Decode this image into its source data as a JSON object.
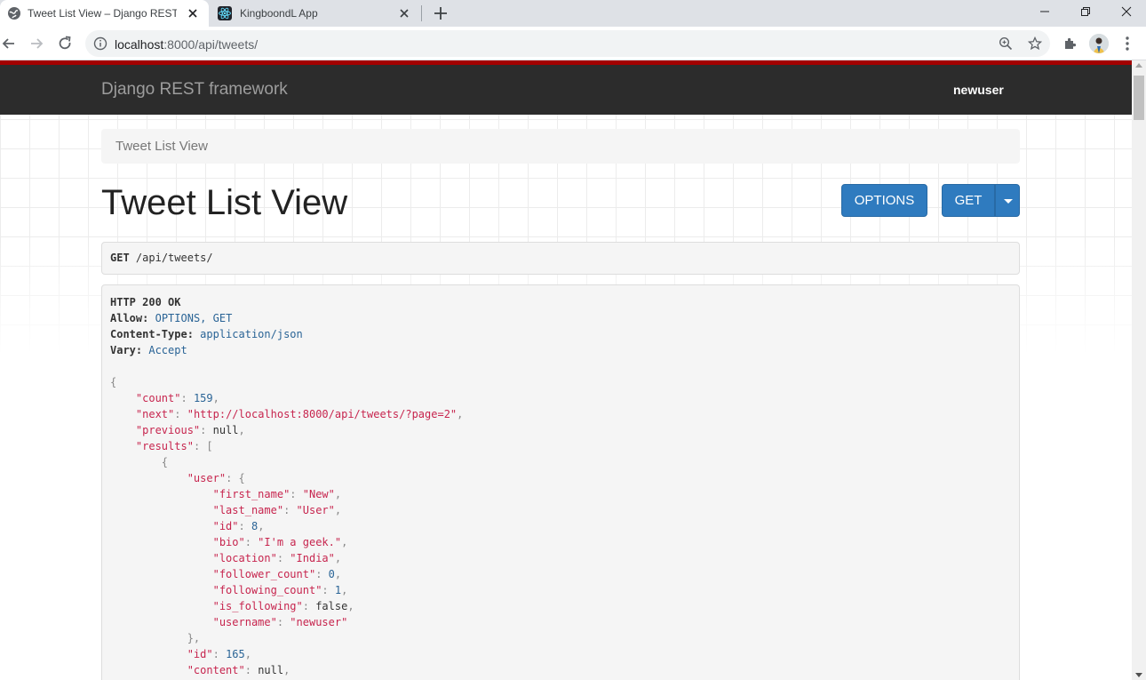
{
  "browser": {
    "tabs": [
      {
        "title": "Tweet List View – Django REST fra",
        "active": true
      },
      {
        "title": "KingboondL App",
        "active": false
      }
    ],
    "url_host": "localhost",
    "url_path": ":8000/api/tweets/"
  },
  "drf": {
    "brand": "Django REST framework",
    "user": "newuser",
    "breadcrumb": "Tweet List View",
    "title": "Tweet List View",
    "options_label": "OPTIONS",
    "get_label": "GET",
    "request_method": "GET",
    "request_path": "/api/tweets/"
  },
  "response": {
    "status": "HTTP 200 OK",
    "headers": [
      {
        "name": "Allow:",
        "value": "OPTIONS, GET"
      },
      {
        "name": "Content-Type:",
        "value": "application/json"
      },
      {
        "name": "Vary:",
        "value": "Accept"
      }
    ],
    "count": "159",
    "next": "\"http://localhost:8000/api/tweets/?page=2\"",
    "previous": "null",
    "user": {
      "first_name": "\"New\"",
      "last_name": "\"User\"",
      "id": "8",
      "bio": "\"I'm a geek.\"",
      "location": "\"India\"",
      "follower_count": "0",
      "following_count": "1",
      "is_following": "false",
      "username": "\"newuser\""
    },
    "id": "165",
    "content": "null"
  },
  "colors": {
    "accent_red": "#a30000",
    "navbar": "#2c2c2c",
    "button_blue": "#2f7bbf",
    "json_key": "#c7254e",
    "json_number": "#2a6496"
  }
}
